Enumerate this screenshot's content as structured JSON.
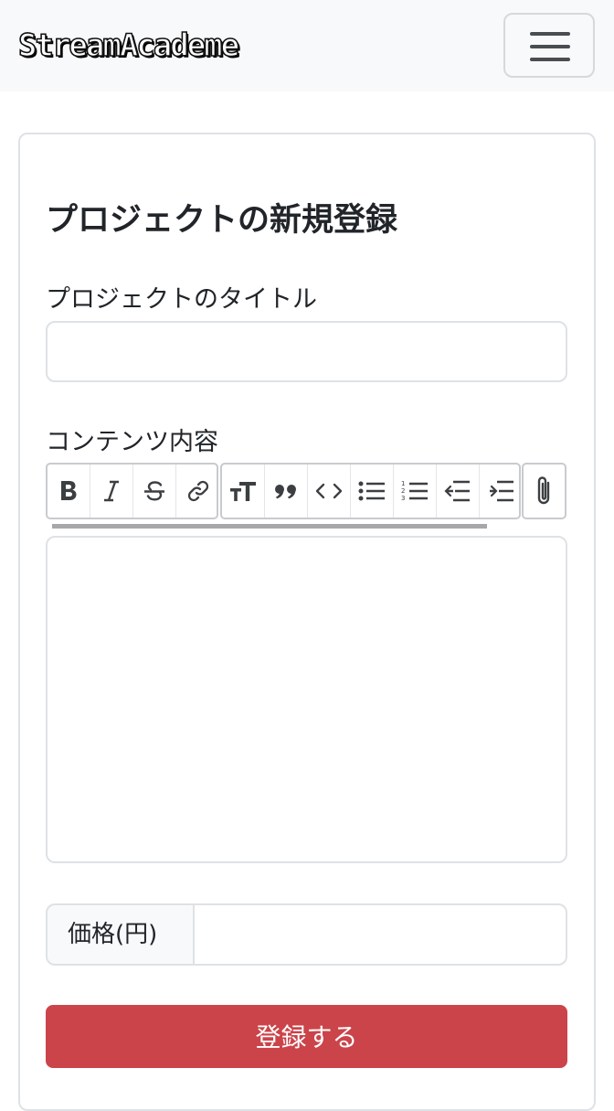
{
  "navbar": {
    "brand": "StreamAcademe",
    "toggle_icon": "hamburger-menu-icon"
  },
  "form": {
    "heading": "プロジェクトの新規登録",
    "title_label": "プロジェクトのタイトル",
    "title_value": "",
    "content_label": "コンテンツ内容",
    "content_value": "",
    "price_label": "価格(円)",
    "price_value": "",
    "submit_label": "登録する"
  },
  "toolbar": {
    "groups": [
      [
        "bold-icon",
        "italic-icon",
        "strikethrough-icon",
        "link-icon"
      ],
      [
        "heading-icon",
        "quote-icon",
        "code-icon",
        "bullet-list-icon",
        "numbered-list-icon",
        "decrease-indent-icon",
        "increase-indent-icon"
      ],
      [
        "attach-files-icon"
      ]
    ]
  },
  "colors": {
    "navbar_bg": "#f8f9fa",
    "submit_button": "#cb444a",
    "border": "#dee2e6",
    "text": "#212529"
  }
}
